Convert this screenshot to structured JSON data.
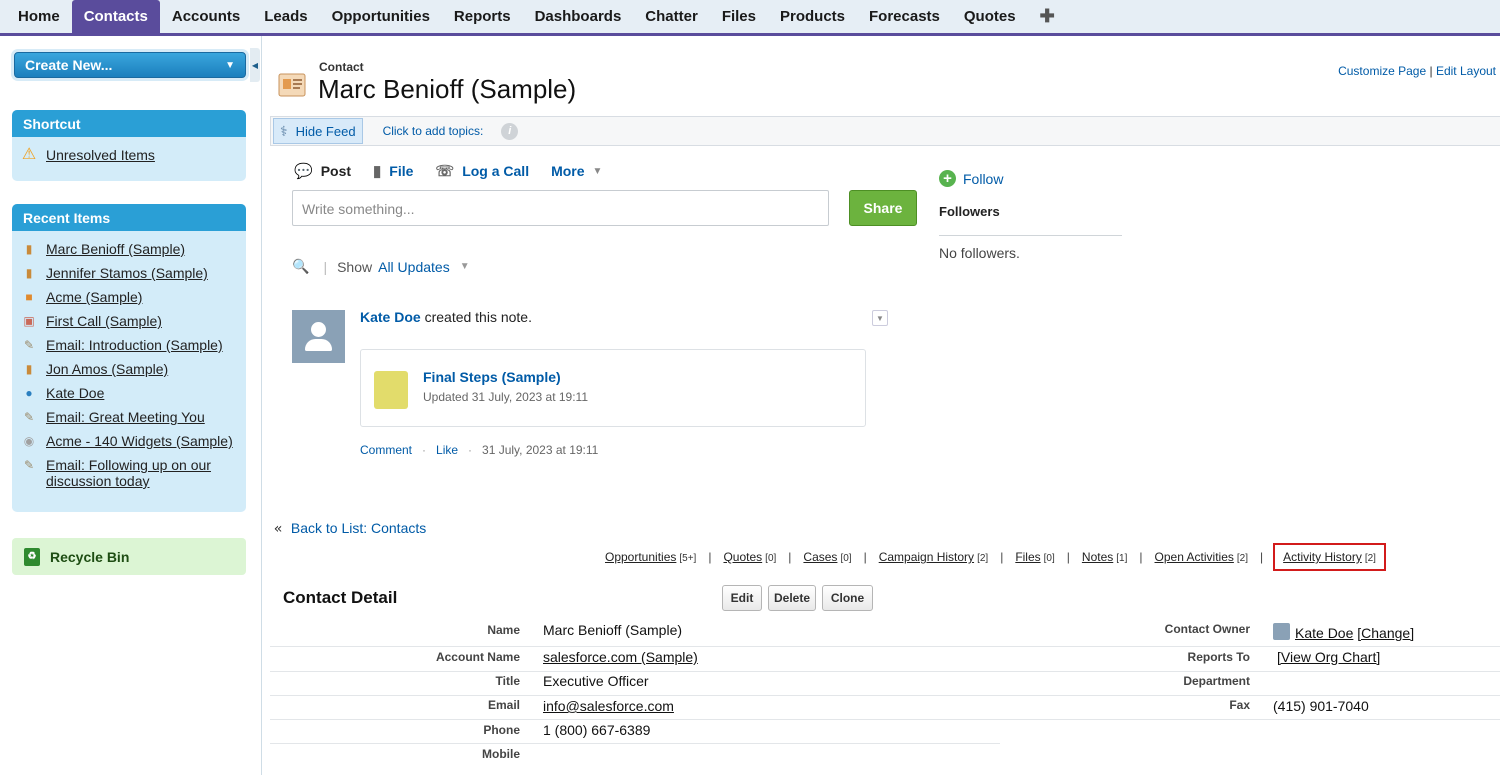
{
  "nav": {
    "tabs": [
      "Home",
      "Contacts",
      "Accounts",
      "Leads",
      "Opportunities",
      "Reports",
      "Dashboards",
      "Chatter",
      "Files",
      "Products",
      "Forecasts",
      "Quotes"
    ],
    "active": "Contacts",
    "plus": "✚"
  },
  "sidebar": {
    "create_new": "Create New...",
    "shortcut_title": "Shortcut",
    "shortcut_items": [
      "Unresolved Items"
    ],
    "recent_title": "Recent Items",
    "recent_items": [
      "Marc Benioff (Sample)",
      "Jennifer Stamos (Sample)",
      "Acme (Sample)",
      "First Call (Sample)",
      "Email: Introduction (Sample)",
      "Jon Amos (Sample)",
      "Kate Doe",
      "Email: Great Meeting You",
      "Acme - 140 Widgets (Sample)",
      "Email: Following up on our discussion today"
    ],
    "recycle_bin": "Recycle Bin"
  },
  "header": {
    "record_type": "Contact",
    "record_title": "Marc Benioff (Sample)",
    "customize_page": "Customize Page",
    "edit_layout": "Edit Layout",
    "link_separator": "|"
  },
  "topics": {
    "hide_feed": "Hide Feed",
    "add_topics": "Click to add topics:"
  },
  "publisher": {
    "tabs": [
      "Post",
      "File",
      "Log a Call",
      "More"
    ],
    "placeholder": "Write something...",
    "share": "Share"
  },
  "followers": {
    "follow": "Follow",
    "title": "Followers",
    "empty": "No followers."
  },
  "feed": {
    "show_label": "Show",
    "filter": "All Updates",
    "post_author": "Kate Doe",
    "post_action": "created this note.",
    "note_title": "Final Steps (Sample)",
    "note_sub": "Updated 31 July, 2023 at 19:11",
    "comment": "Comment",
    "like": "Like",
    "timestamp": "31 July, 2023 at 19:11"
  },
  "related": {
    "back": "Back to List: Contacts",
    "links": [
      {
        "label": "Opportunities",
        "count": "[5+]"
      },
      {
        "label": "Quotes",
        "count": "[0]"
      },
      {
        "label": "Cases",
        "count": "[0]"
      },
      {
        "label": "Campaign History",
        "count": "[2]"
      },
      {
        "label": "Files",
        "count": "[0]"
      },
      {
        "label": "Notes",
        "count": "[1]"
      },
      {
        "label": "Open Activities",
        "count": "[2]"
      },
      {
        "label": "Activity History",
        "count": "[2]"
      }
    ]
  },
  "detail": {
    "title": "Contact Detail",
    "buttons": [
      "Edit",
      "Delete",
      "Clone"
    ],
    "left": [
      {
        "label": "Name",
        "value": "Marc Benioff (Sample)"
      },
      {
        "label": "Account Name",
        "value": "salesforce.com (Sample)"
      },
      {
        "label": "Title",
        "value": "Executive Officer"
      },
      {
        "label": "Email",
        "value": "info@salesforce.com"
      },
      {
        "label": "Phone",
        "value": "1 (800) 667-6389"
      },
      {
        "label": "Mobile",
        "value": ""
      }
    ],
    "right": [
      {
        "label": "Contact Owner",
        "value": "Kate Doe",
        "extra": "[Change]"
      },
      {
        "label": "Reports To",
        "value": "[View Org Chart]"
      },
      {
        "label": "Department",
        "value": ""
      },
      {
        "label": "Fax",
        "value": "(415) 901-7040"
      }
    ]
  }
}
